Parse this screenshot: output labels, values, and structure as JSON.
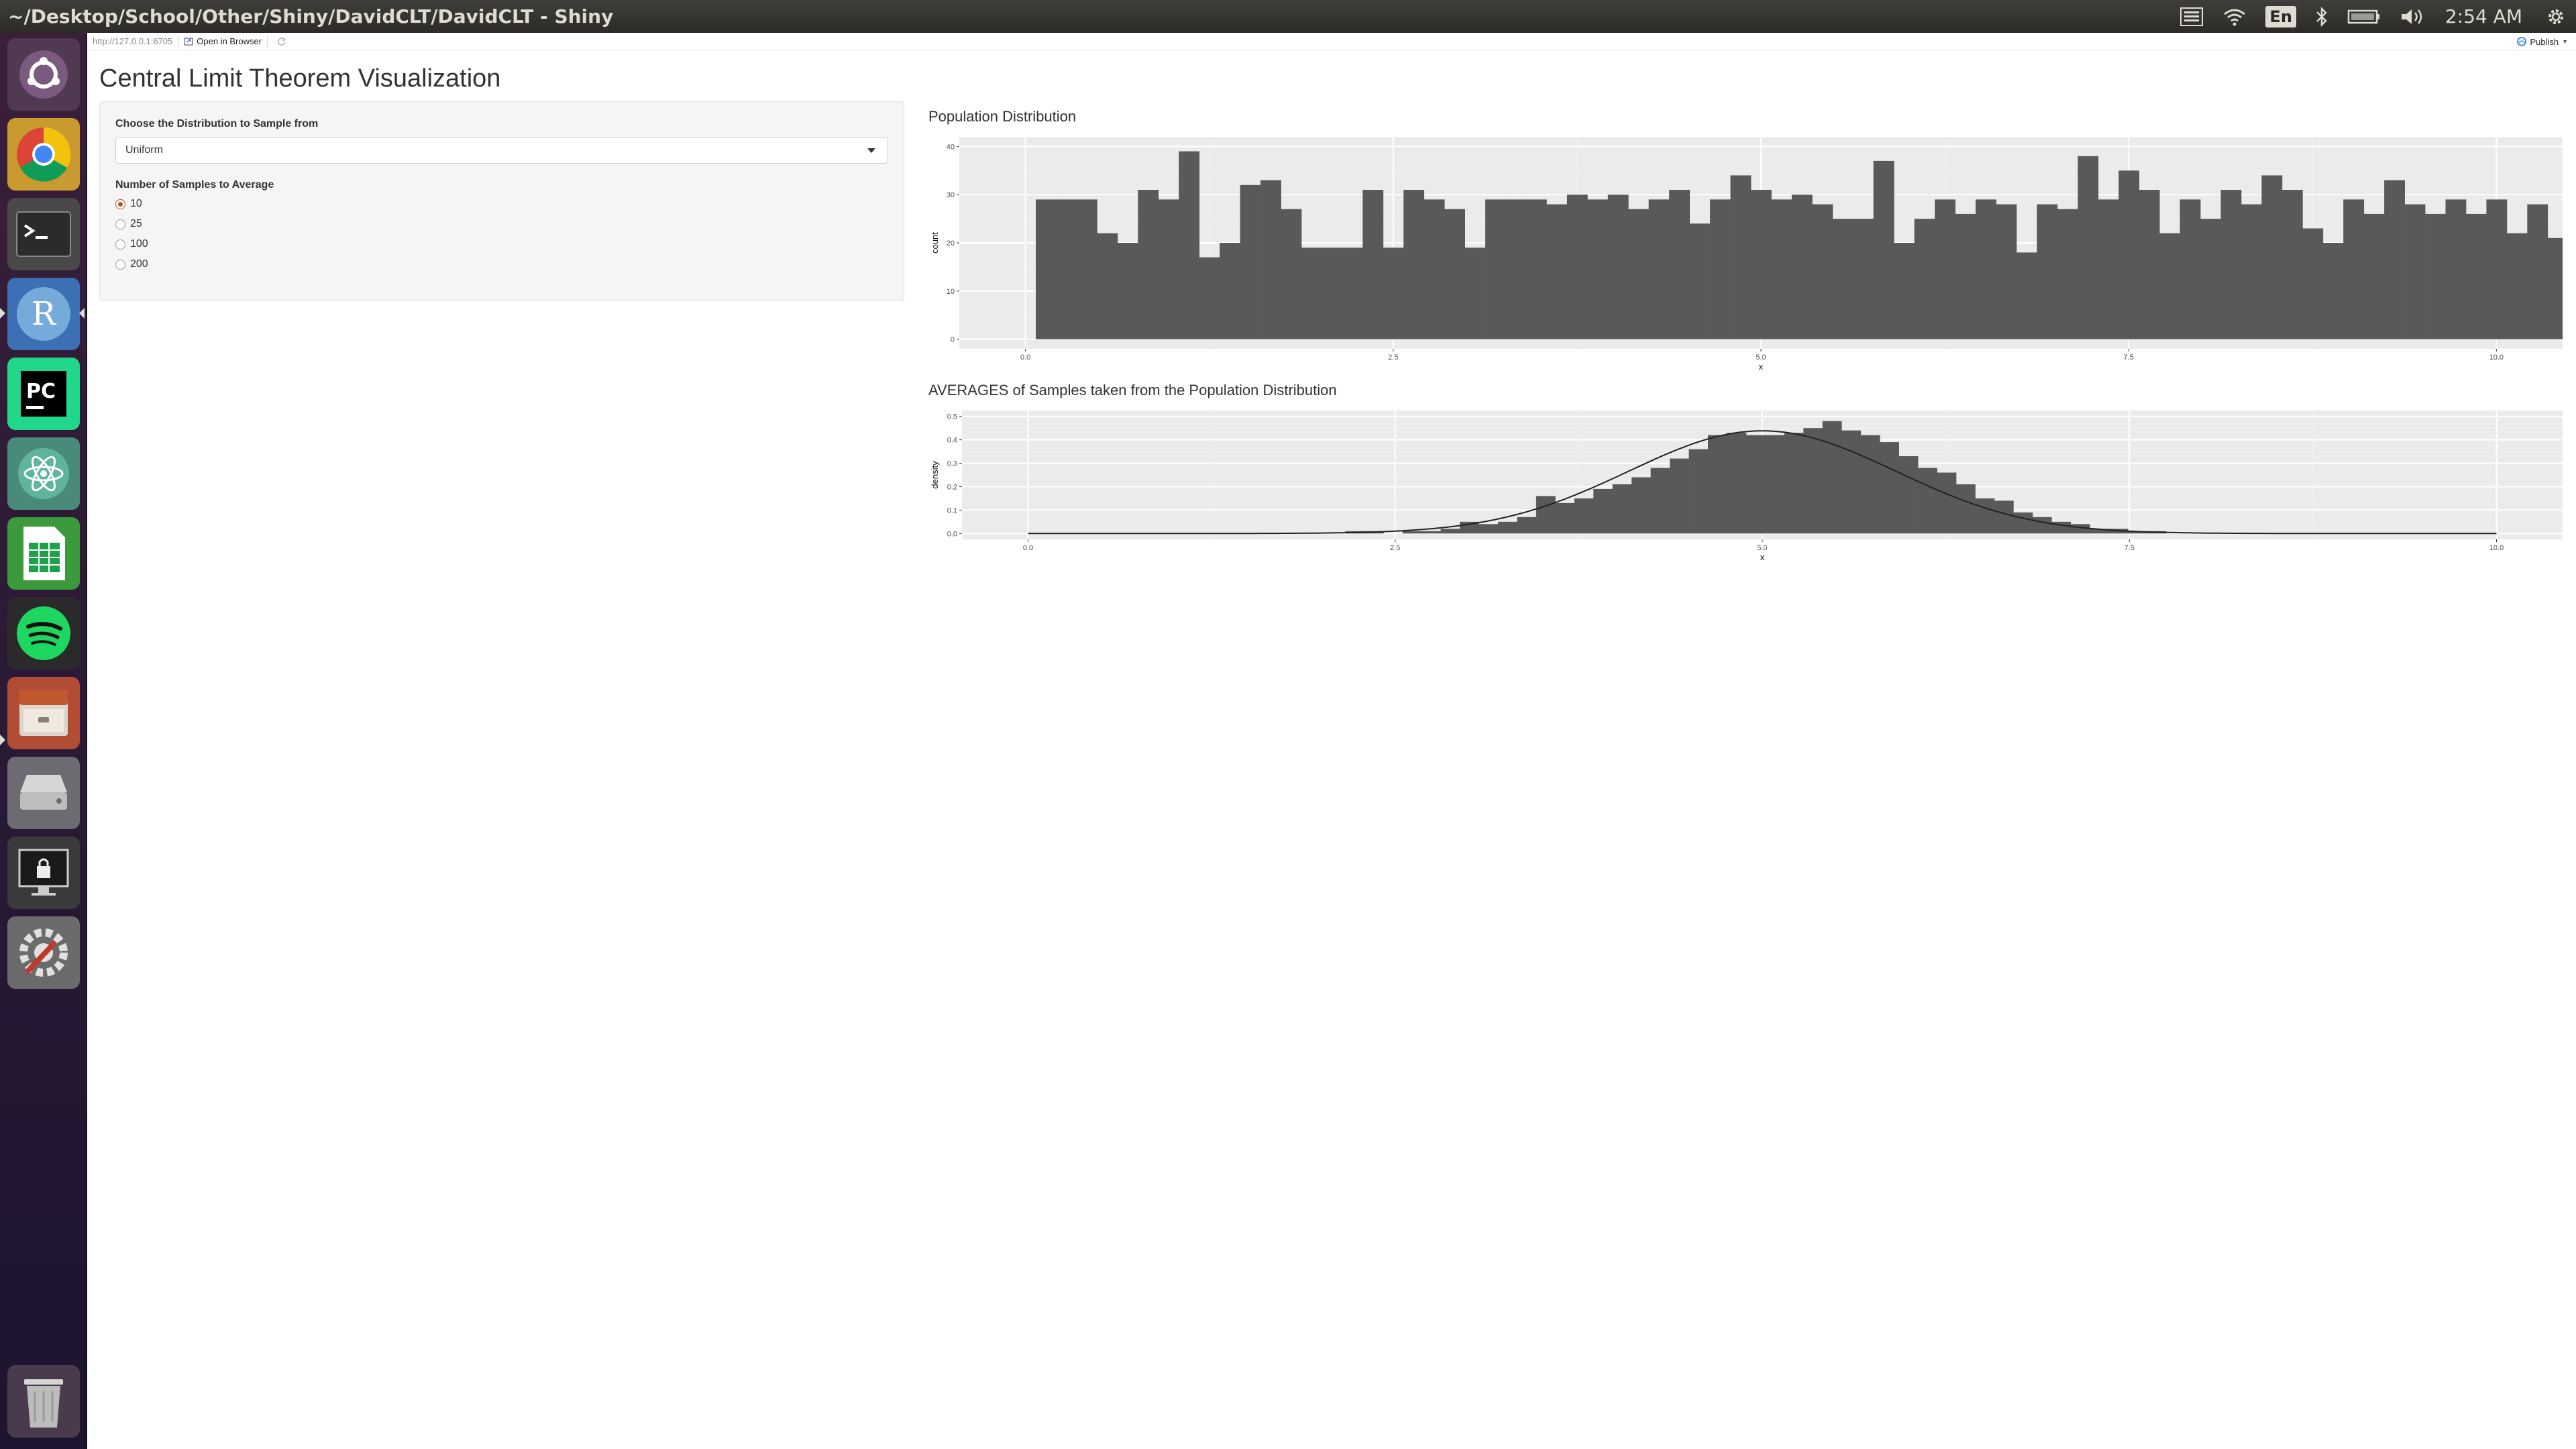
{
  "window": {
    "title": "~/Desktop/School/Other/Shiny/DavidCLT/DavidCLT - Shiny",
    "keyboard_layout": "En",
    "clock": "2:54 AM"
  },
  "launcher": {
    "icons": [
      "ubuntu-dash-icon",
      "chrome-icon",
      "terminal-icon",
      "rstudio-icon",
      "pycharm-icon",
      "atom-icon",
      "libreoffice-calc-icon",
      "spotify-icon",
      "file-manager-icon",
      "disk-drive-icon",
      "screen-lock-icon",
      "system-settings-icon",
      "trash-icon"
    ]
  },
  "viewer_toolbar": {
    "url": "http://127.0.0.1:6705",
    "open_in_browser": "Open in Browser",
    "publish": "Publish"
  },
  "app": {
    "title": "Central Limit Theorem Visualization",
    "distribution_label": "Choose the Distribution to Sample from",
    "distribution_selected": "Uniform",
    "samples_label": "Number of Samples to Average",
    "sample_options": [
      "10",
      "25",
      "100",
      "200"
    ],
    "sample_selected": "10"
  },
  "colors": {
    "bar_fill": "#595959",
    "panel_bg": "#ebebeb",
    "grid": "#ffffff",
    "radio_accent": "#c0502a"
  },
  "chart_data": [
    {
      "type": "bar",
      "title": "Population Distribution",
      "xlabel": "x",
      "ylabel": "count",
      "xlim": [
        0,
        10
      ],
      "ylim": [
        0,
        40
      ],
      "x_ticks": [
        "0.0",
        "2.5",
        "5.0",
        "7.5",
        "10.0"
      ],
      "y_ticks": [
        "0",
        "10",
        "20",
        "30",
        "40"
      ],
      "bin_width": 0.1389,
      "bin_start": 0.07,
      "values": [
        29,
        29,
        29,
        22,
        20,
        31,
        29,
        39,
        17,
        20,
        32,
        33,
        27,
        19,
        19,
        19,
        31,
        19,
        31,
        29,
        27,
        19,
        29,
        29,
        29,
        28,
        30,
        29,
        30,
        27,
        29,
        31,
        24,
        29,
        34,
        31,
        29,
        30,
        28,
        25,
        25,
        37,
        20,
        25,
        29,
        26,
        29,
        28,
        18,
        28,
        27,
        38,
        29,
        35,
        31,
        22,
        29,
        25,
        31,
        28,
        34,
        31,
        23,
        20,
        29,
        26,
        33,
        28,
        26,
        29,
        26,
        29,
        22,
        28,
        21,
        21,
        26,
        26
      ],
      "grid": true
    },
    {
      "type": "bar",
      "title": "AVERAGES of Samples taken from the Population Distribution",
      "xlabel": "x",
      "ylabel": "density",
      "xlim": [
        0,
        10
      ],
      "ylim": [
        0,
        0.5
      ],
      "x_ticks": [
        "0.0",
        "2.5",
        "5.0",
        "7.5",
        "10.0"
      ],
      "y_ticks": [
        "0.0",
        "0.1",
        "0.2",
        "0.3",
        "0.4",
        "0.5"
      ],
      "bin_start": 1.9,
      "bin_width": 0.13,
      "values": [
        0.0,
        0.0,
        0.01,
        0.01,
        0.0,
        0.01,
        0.01,
        0.02,
        0.05,
        0.04,
        0.05,
        0.07,
        0.16,
        0.13,
        0.15,
        0.19,
        0.21,
        0.24,
        0.28,
        0.32,
        0.36,
        0.42,
        0.43,
        0.42,
        0.42,
        0.43,
        0.45,
        0.48,
        0.44,
        0.42,
        0.39,
        0.33,
        0.28,
        0.26,
        0.21,
        0.15,
        0.14,
        0.09,
        0.07,
        0.05,
        0.04,
        0.02,
        0.02,
        0.01,
        0.01,
        0.0
      ],
      "density_curve": {
        "mean": 5.0,
        "sd": 0.91
      },
      "grid": true
    }
  ]
}
